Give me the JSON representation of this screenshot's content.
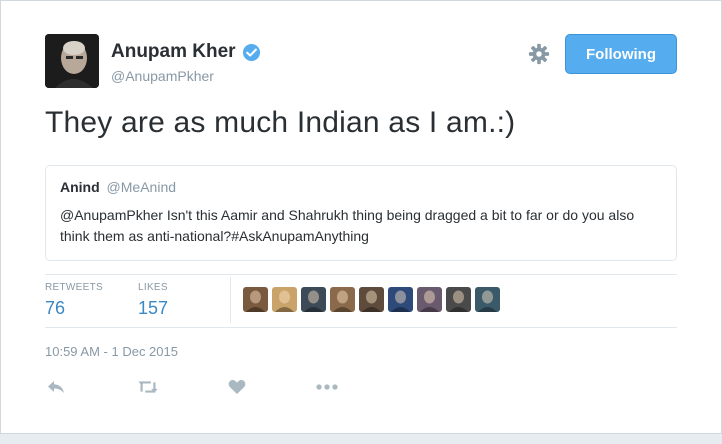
{
  "author": {
    "name": "Anupam Kher",
    "handle": "@AnupamPkher",
    "verified_icon": "verified-badge-icon"
  },
  "follow_button": {
    "label": "Following"
  },
  "tweet": {
    "text": "They are as much Indian as I am.:)"
  },
  "quoted_tweet": {
    "name": "Anind",
    "handle": "@MeAnind",
    "text": "@AnupamPkher Isn't this Aamir and Shahrukh thing being dragged a bit to far or do you also think them as anti-national?#AskAnupamAnything"
  },
  "stats": {
    "retweets_label": "RETWEETS",
    "retweets_value": "76",
    "likes_label": "LIKES",
    "likes_value": "157"
  },
  "likers": [
    {
      "color": "#7a5a3e"
    },
    {
      "color": "#c9a36a"
    },
    {
      "color": "#3d4a57"
    },
    {
      "color": "#8a6a4a"
    },
    {
      "color": "#5e4b3b"
    },
    {
      "color": "#2e4a7a"
    },
    {
      "color": "#6a5a6e"
    },
    {
      "color": "#4a4a4a"
    },
    {
      "color": "#3a5a6a"
    }
  ],
  "timestamp": "10:59 AM - 1 Dec 2015",
  "colors": {
    "accent": "#55acee",
    "link": "#3b88c3",
    "muted": "#8899a6"
  }
}
